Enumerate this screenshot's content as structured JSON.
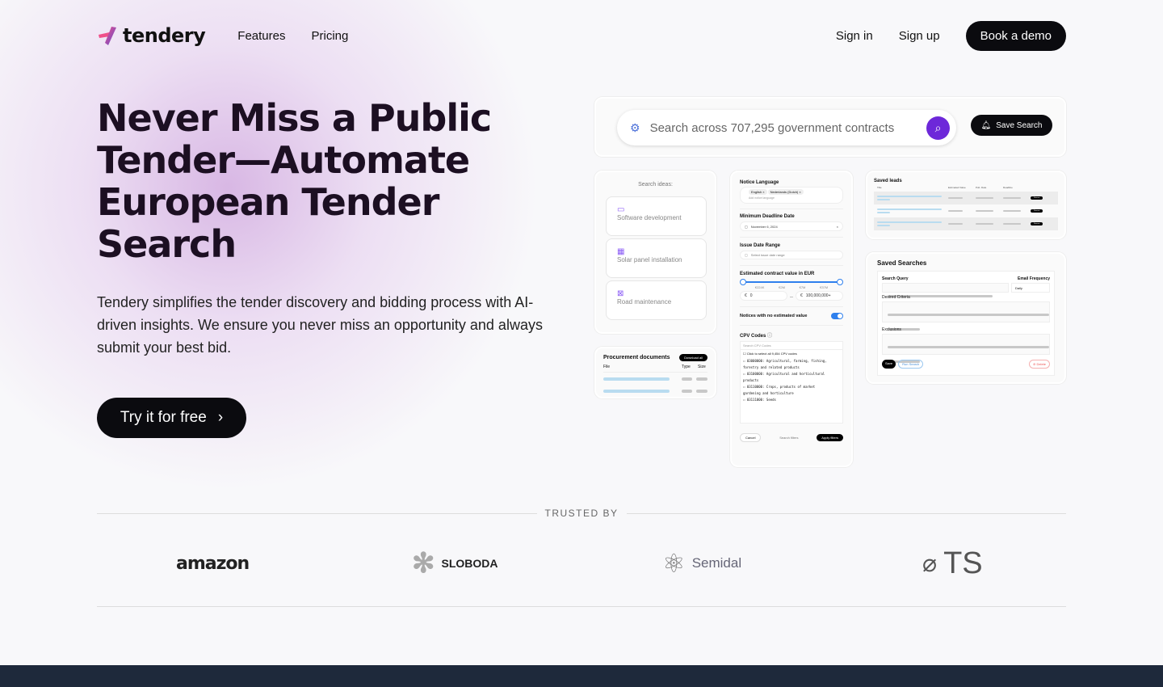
{
  "nav": {
    "brand": "tendery",
    "links": [
      "Features",
      "Pricing"
    ],
    "sign_in": "Sign in",
    "sign_up": "Sign up",
    "book_demo": "Book a demo"
  },
  "hero": {
    "title": "Never Miss a Public Tender—Automate European Tender Search",
    "lead": "Tendery simplifies the tender discovery and bidding process with AI-driven insights. We ensure you never miss an opportunity and always submit your best bid.",
    "cta": "Try it for free"
  },
  "preview": {
    "search_placeholder": "Search across 707,295 government contracts",
    "save_search": "Save Search",
    "ideas_title": "Search ideas:",
    "ideas": [
      "Software development",
      "Solar panel installation",
      "Road maintenance"
    ],
    "docs": {
      "title": "Procurement documents",
      "download": "Download all",
      "cols": [
        "File",
        "Type",
        "Size"
      ]
    },
    "filters": {
      "lang_title": "Notice Language",
      "lang_tags": [
        "English ×",
        "Nederlands (Dutch) ×"
      ],
      "lang_placeholder": "Add notice language",
      "deadline_title": "Minimum Deadline Date",
      "deadline_value": "November 6, 2024",
      "issue_title": "Issue Date Range",
      "issue_placeholder": "Select issue date range",
      "value_title": "Estimated contract value in EUR",
      "ticks": [
        "€224K",
        "€2M",
        "€7M",
        "€37M"
      ],
      "min": "0",
      "max": "100,000,000+",
      "no_value": "Notices with no estimated value",
      "no_value_on": true,
      "cpv_title": "CPV Codes",
      "cpv_placeholder": "Search CPV Codes",
      "cpv_select_all": "Click to select all 9,454 CPV codes",
      "cpv": [
        "03000000: Agricultural, farming, fishing, forestry and related products",
        "03100000: Agricultural and horticultural products",
        "03110000: Crops, products of market gardening and horticulture",
        "03111000: Seeds"
      ],
      "cancel": "Cancel",
      "search_filters": "Search filters",
      "apply": "Apply filters"
    },
    "leads": {
      "title": "Saved leads",
      "cols": [
        "Title",
        "Estimated Value",
        "Pub. Date",
        "Deadline"
      ],
      "remove": "Remove"
    },
    "saved": {
      "title": "Saved Searches",
      "query": "Search Query",
      "freq": "Email Frequency",
      "freq_value": "Daily",
      "criteria": "Desired Criteria",
      "exclusions": "Exclusions",
      "save": "Save",
      "run": "Run Search",
      "delete": "Delete"
    }
  },
  "trusted": {
    "label": "TRUSTED BY",
    "logos": [
      "amazon",
      "SLOBODA",
      "Semidal",
      "TS"
    ]
  },
  "colors": {
    "accent": "#6d28d9",
    "toggle": "#2f80ed",
    "dark": "#0b0b0f",
    "footer": "#1e293b"
  }
}
